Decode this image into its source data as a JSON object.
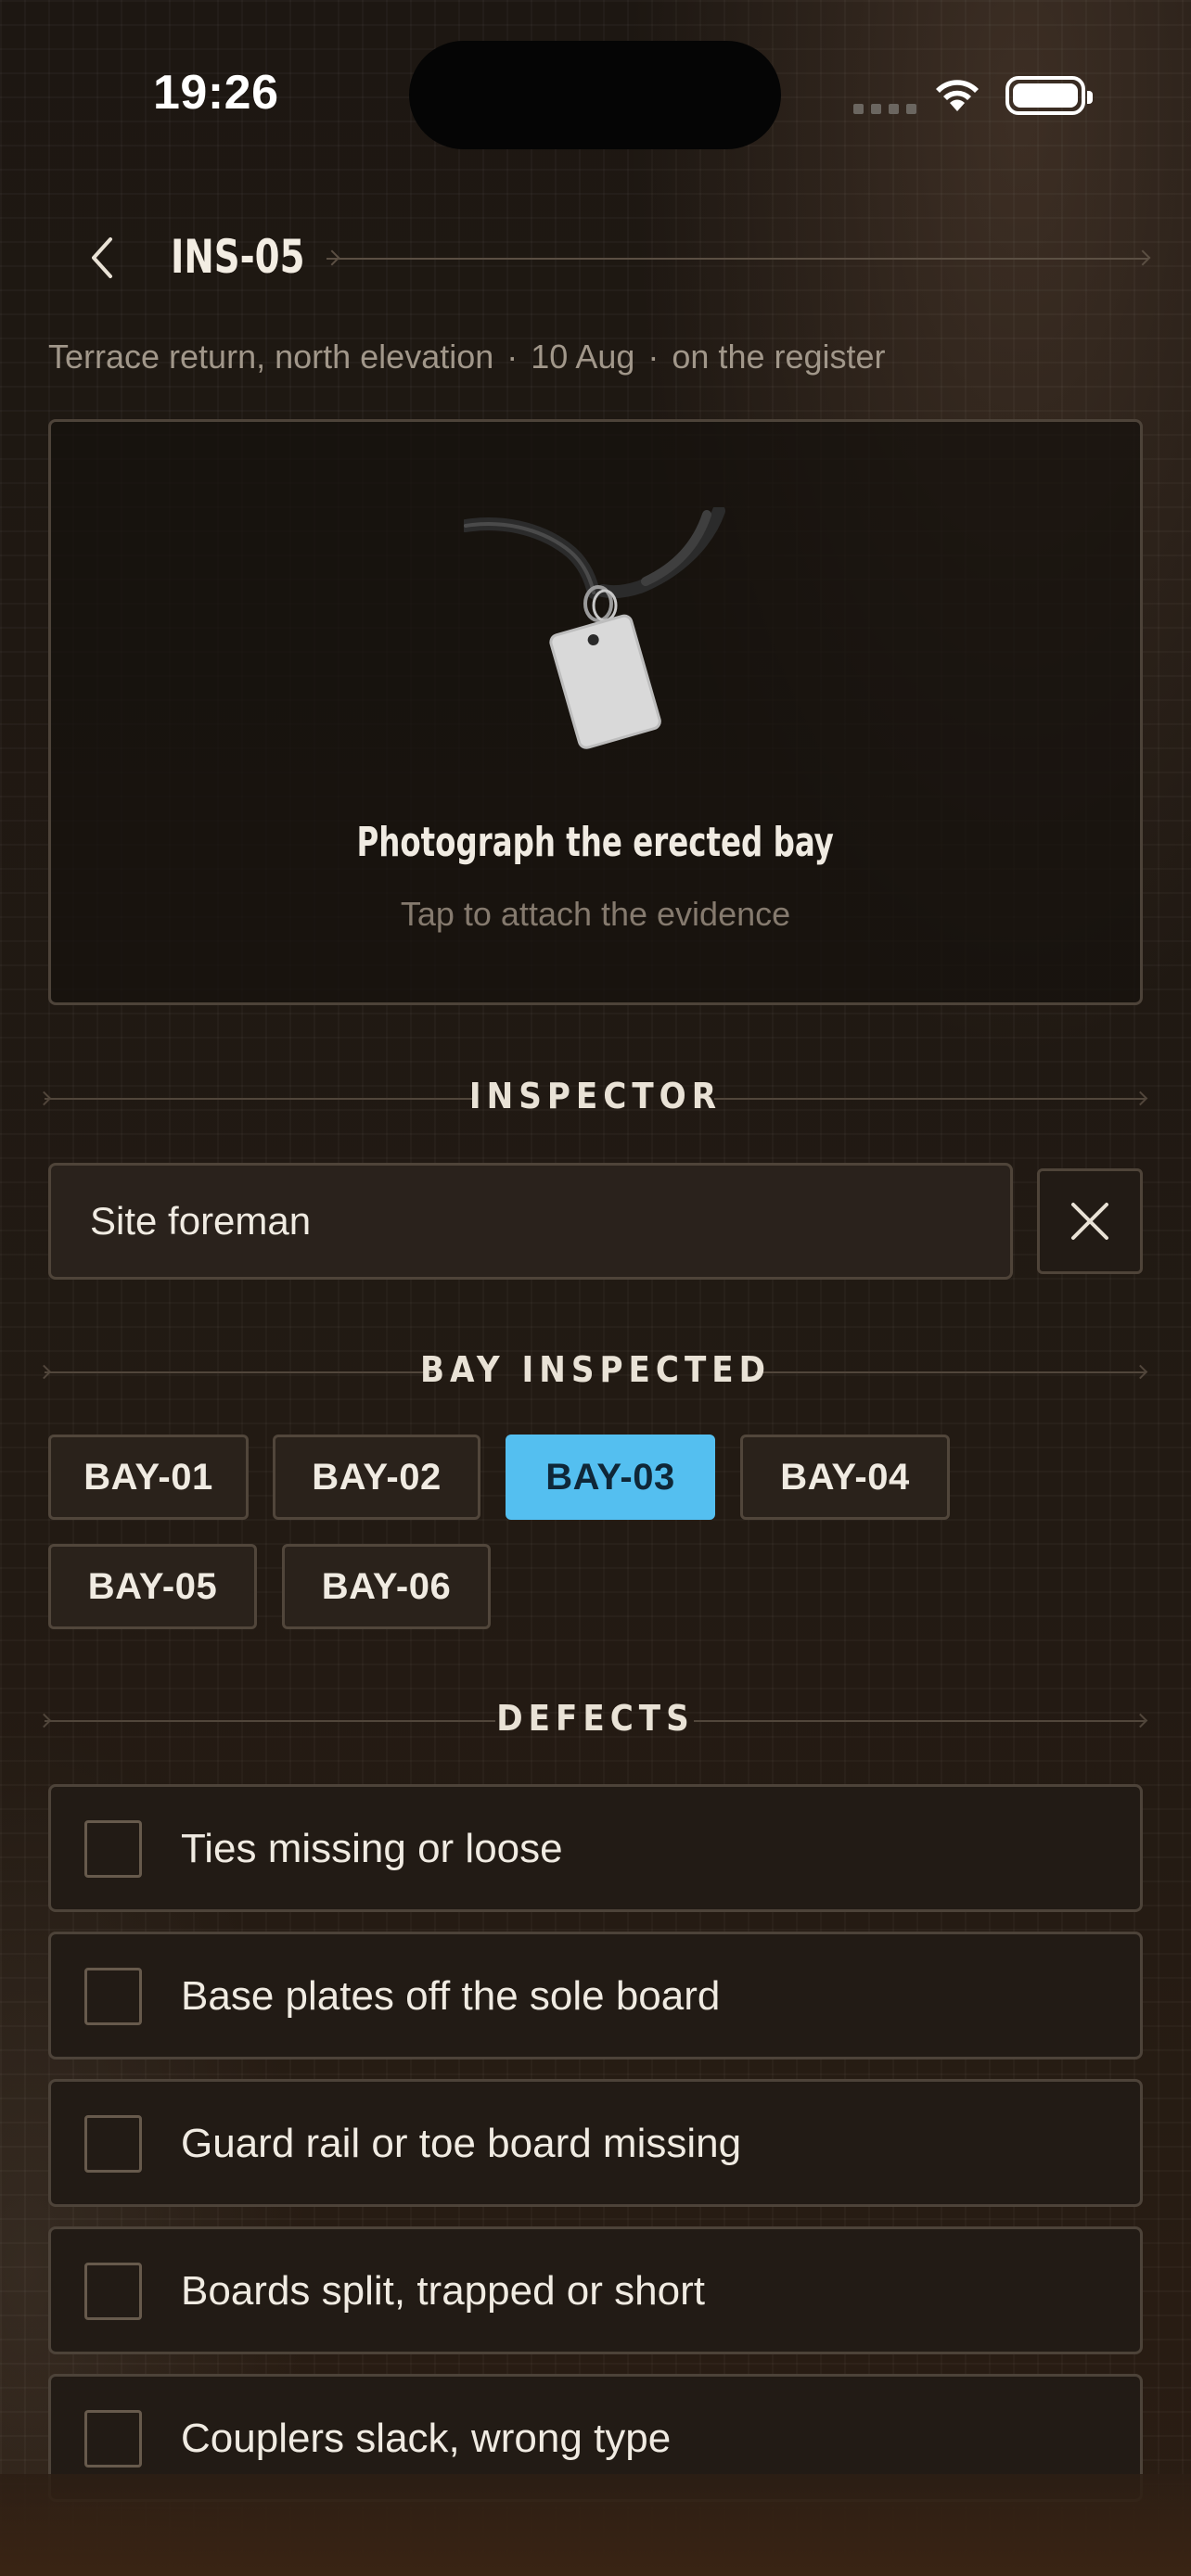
{
  "status_bar": {
    "time": "19:26"
  },
  "header": {
    "title": "INS-05"
  },
  "meta": {
    "location": "Terrace return, north elevation",
    "date": "10 Aug",
    "state": "on the register",
    "separator": "·"
  },
  "photo": {
    "title": "Photograph the erected bay",
    "subtitle": "Tap to attach the evidence",
    "icon": "tag-on-lanyard-icon"
  },
  "sections": {
    "inspector": "INSPECTOR",
    "bay": "BAY INSPECTED",
    "defects": "DEFECTS"
  },
  "inspector": {
    "value": "Site foreman"
  },
  "bays": [
    {
      "label": "BAY-01",
      "selected": false
    },
    {
      "label": "BAY-02",
      "selected": false
    },
    {
      "label": "BAY-03",
      "selected": true
    },
    {
      "label": "BAY-04",
      "selected": false
    },
    {
      "label": "BAY-05",
      "selected": false
    },
    {
      "label": "BAY-06",
      "selected": false
    }
  ],
  "defects": [
    {
      "label": "Ties missing or loose",
      "checked": false
    },
    {
      "label": "Base plates off the sole board",
      "checked": false
    },
    {
      "label": "Guard rail or toe board missing",
      "checked": false
    },
    {
      "label": "Boards split, trapped or short",
      "checked": false
    },
    {
      "label": "Couplers slack, wrong type",
      "checked": false
    }
  ],
  "colors": {
    "accent": "#54bff0",
    "background": "#1e1812",
    "border": "#4d4339"
  }
}
